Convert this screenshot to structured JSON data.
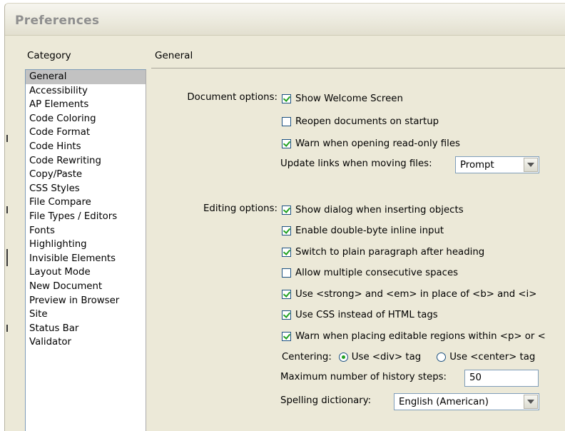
{
  "window": {
    "title": "Preferences"
  },
  "category_header": "Category",
  "section_header": "General",
  "categories": [
    "General",
    "Accessibility",
    "AP Elements",
    "Code Coloring",
    "Code Format",
    "Code Hints",
    "Code Rewriting",
    "Copy/Paste",
    "CSS Styles",
    "File Compare",
    "File Types / Editors",
    "Fonts",
    "Highlighting",
    "Invisible Elements",
    "Layout Mode",
    "New Document",
    "Preview in Browser",
    "Site",
    "Status Bar",
    "Validator"
  ],
  "selected_category": "General",
  "document_options": {
    "label": "Document options:",
    "show_welcome": {
      "label": "Show Welcome Screen",
      "checked": true
    },
    "reopen_docs": {
      "label": "Reopen documents on startup",
      "checked": false
    },
    "warn_readonly": {
      "label": "Warn when opening read-only files",
      "checked": true
    },
    "update_links": {
      "label": "Update links when moving files:",
      "value": "Prompt"
    }
  },
  "editing_options": {
    "label": "Editing options:",
    "show_dialog": {
      "label": "Show dialog when inserting objects",
      "checked": true
    },
    "double_byte": {
      "label": "Enable double-byte inline input",
      "checked": true
    },
    "plain_paragraph": {
      "label": "Switch to plain paragraph after heading",
      "checked": true
    },
    "multiple_spaces": {
      "label": "Allow multiple consecutive spaces",
      "checked": false
    },
    "strong_em": {
      "label": "Use <strong> and <em> in place of <b> and <i>",
      "checked": true
    },
    "use_css": {
      "label": "Use CSS instead of HTML tags",
      "checked": true
    },
    "warn_editable": {
      "label": "Warn when placing editable regions within <p> or <",
      "checked": true
    },
    "centering": {
      "label": "Centering:",
      "option_div": "Use <div> tag",
      "option_center": "Use <center> tag",
      "selected": "div"
    },
    "history": {
      "label": "Maximum number of history steps:",
      "value": "50"
    },
    "spelling": {
      "label": "Spelling dictionary:",
      "value": "English (American)"
    }
  },
  "colors": {
    "dialog_bg": "#ece9d8",
    "check_green": "#21a121",
    "selection_bg": "#c2c2c2",
    "input_border": "#7f9db9"
  }
}
